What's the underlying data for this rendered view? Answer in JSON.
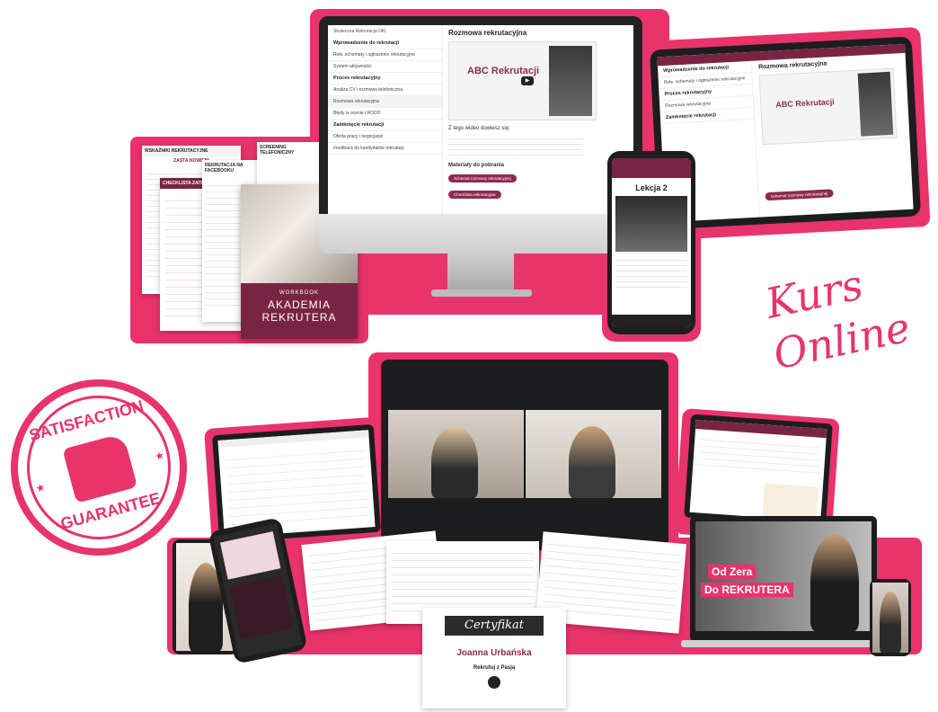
{
  "course": {
    "module_title": "Rozmowa rekrutacyjna",
    "video_title": "ABC Rekrutacji",
    "sections": [
      "Wprowadzenie do rekrutacji",
      "Proces rekrutacyjny",
      "Zamknięcie rekrutacji"
    ],
    "lessons": [
      "Role, schematy i ogłoszenie rekrutacyjne",
      "System aktywności",
      "Analiza CV i rozmowa telefoniczna",
      "Rozmowa rekrutacyjna",
      "Błędy w ocenie i RODO",
      "Oferta pracy i negocjacje",
      "Feedback do kandydatów rekrutacji"
    ],
    "video_note": "Z tego wideo dowiesz się:",
    "materials_label": "Materiały do pobrania",
    "download_buttons": [
      "Schemat rozmowy rekrutacyjnej",
      "Checklista rekrutacyjna"
    ],
    "breadcrumb": "Skuteczna Rekrutacja OKI"
  },
  "phone": {
    "lesson_label": "Lekcja 2",
    "side_note": "Od zera do rekrutera"
  },
  "workbook": {
    "label": "WORKBOOK",
    "title_line1": "AKADEMIA",
    "title_line2": "REKRUTERA"
  },
  "papers": {
    "p1": "WSKAŹNIKI REKRUTACYJNE",
    "p1_sub": "ZASTA.NOWIENI",
    "p2": "CHECKLISTA ZATRUDNIENIA",
    "p3": "REKRUTACJA NA FACEBOOKU",
    "p4": "SCREENING TELEFONICZNY"
  },
  "badge_text": {
    "top": "SATISFACTION",
    "bottom": "GUARANTEE"
  },
  "headline": {
    "line1": "Kurs",
    "line2": "Online"
  },
  "promo": {
    "line1": "Od Zera",
    "line2": "Do REKRUTERA"
  },
  "certificate": {
    "title": "Certyfikat",
    "name": "Joanna Urbańska",
    "brand": "Rekrutuj z Pasją"
  },
  "colors": {
    "accent": "#e8336b",
    "maroon": "#7a2443",
    "dark": "#1d1d1f"
  }
}
